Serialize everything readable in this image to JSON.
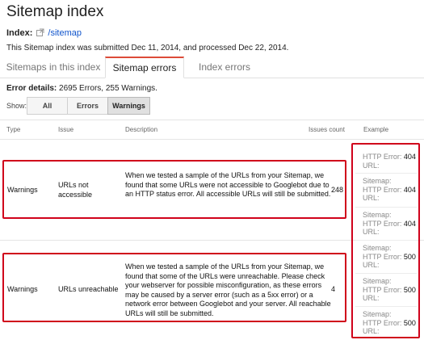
{
  "page": {
    "title": "Sitemap index",
    "index_label": "Index:",
    "index_link": "/sitemap",
    "submitted_text": "This Sitemap index was submitted Dec 11, 2014, and processed Dec 22, 2014."
  },
  "tabs": [
    {
      "label": "Sitemaps in this index",
      "active": false
    },
    {
      "label": "Sitemap errors",
      "active": true
    },
    {
      "label": "Index errors",
      "active": false
    }
  ],
  "summary": {
    "label": "Error details:",
    "value": "2695 Errors, 255 Warnings."
  },
  "filter": {
    "show_label": "Show:",
    "buttons": [
      "All",
      "Errors",
      "Warnings"
    ],
    "selected": "Warnings"
  },
  "table": {
    "headers": {
      "type": "Type",
      "issue": "Issue",
      "description": "Description",
      "count": "Issues count",
      "example": "Example"
    },
    "rows": [
      {
        "type": "Warnings",
        "issue": "URLs not accessible",
        "description": "When we tested a sample of the URLs from your Sitemap, we found that some URLs were not accessible to Googlebot due to an HTTP status error. All accessible URLs will still be submitted.",
        "count": "248"
      },
      {
        "type": "Warnings",
        "issue": "URLs unreachable",
        "description": "When we tested a sample of the URLs from your Sitemap, we found that some of the URLs were unreachable. Please check your webserver for possible misconfiguration, as these errors may be caused by a server error (such as a 5xx error) or a network error between Googlebot and your server. All reachable URLs will still be submitted.",
        "count": "4"
      }
    ],
    "examples": [
      {
        "prefix": "",
        "label": "HTTP Error:",
        "code": "404",
        "url_label": "URL:"
      },
      {
        "prefix": "Sitemap:",
        "label": "HTTP Error:",
        "code": "404",
        "url_label": "URL:"
      },
      {
        "prefix": "Sitemap:",
        "label": "HTTP Error:",
        "code": "404",
        "url_label": "URL:"
      },
      {
        "prefix": "Sitemap:",
        "label": "HTTP Error:",
        "code": "500",
        "url_label": "URL:"
      },
      {
        "prefix": "Sitemap:",
        "label": "HTTP Error:",
        "code": "500",
        "url_label": "URL:"
      },
      {
        "prefix": "Sitemap:",
        "label": "HTTP Error:",
        "code": "500",
        "url_label": "URL:"
      }
    ]
  },
  "colors": {
    "link": "#1155cc",
    "highlight": "#d0021b",
    "active_tab": "#dd4b39"
  }
}
